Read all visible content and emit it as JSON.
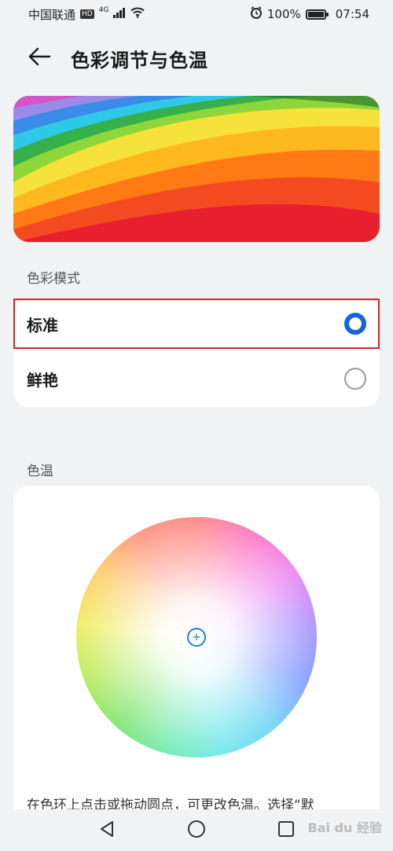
{
  "status_bar": {
    "carrier": "中国联通",
    "hd": "HD",
    "network": "4G",
    "battery_percent": "100%",
    "time": "07:54"
  },
  "header": {
    "title": "色彩调节与色温",
    "back_icon": "arrow-left-icon"
  },
  "color_mode": {
    "section_label": "色彩模式",
    "options": [
      {
        "label": "标准",
        "selected": true
      },
      {
        "label": "鲜艳",
        "selected": false
      }
    ]
  },
  "color_temp": {
    "section_label": "色温",
    "hint": "在色环上点击或拖动圆点，可更改色温。选择“默"
  },
  "nav_bar": {
    "icons": [
      "back-triangle-icon",
      "home-circle-icon",
      "recents-square-icon"
    ]
  },
  "watermark": "Bai du 经验",
  "colors": {
    "accent": "#1565d8",
    "highlight_border": "#c9282e",
    "background": "#f1f2f4"
  }
}
